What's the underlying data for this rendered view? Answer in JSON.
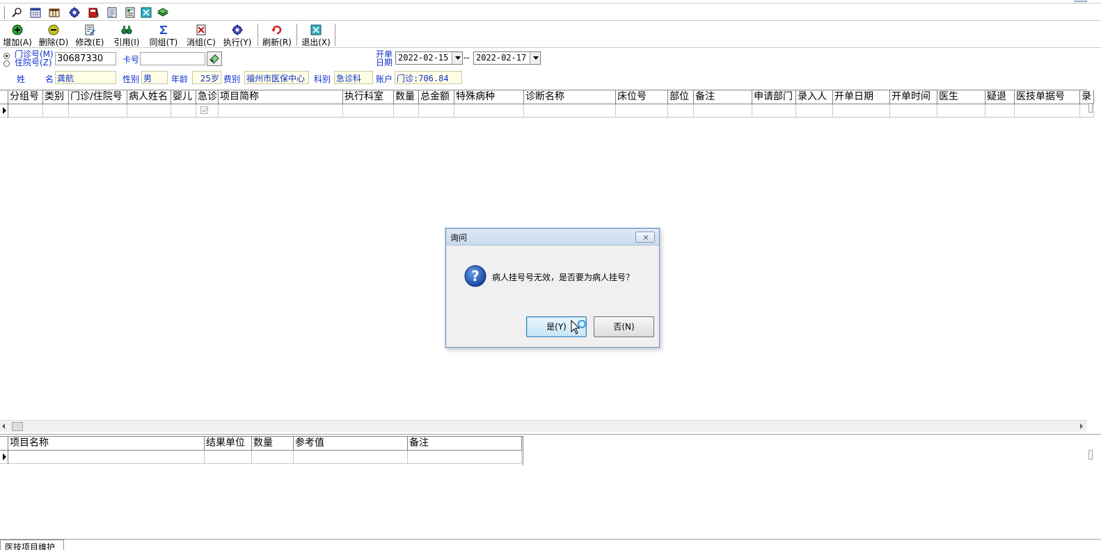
{
  "colors": {
    "label_blue": "#1030c8",
    "field_yellow": "#ffffe6"
  },
  "icon_toolbar": {
    "icons": [
      "search-icon",
      "calendar-icon",
      "table-icon",
      "gear-icon",
      "book-icon",
      "list-icon",
      "form-icon",
      "exit-icon",
      "stack-icon"
    ]
  },
  "toolbar": {
    "add": "增加(A)",
    "delete": "删除(D)",
    "edit": "修改(E)",
    "reference": "引用(I)",
    "group": "同组(T)",
    "ungroup": "消组(C)",
    "execute": "执行(Y)",
    "refresh": "刷新(R)",
    "exit": "退出(X)"
  },
  "patient": {
    "outpatient_label": "门诊号(M)",
    "inpatient_label": "住院号(Z)",
    "number": "30687330",
    "card_label": "卡号",
    "card_value": "",
    "name_label_1": "姓",
    "name_label_2": "名",
    "name": "龚航",
    "sex_label": "性别",
    "sex": "男",
    "age_label": "年龄",
    "age": "25岁",
    "fee_label": "费别",
    "fee": "福州市医保中心",
    "dept_label": "科别",
    "dept": "急诊科",
    "account_label": "账户",
    "account": "门诊:706.84",
    "date_label_1": "开单",
    "date_label_2": "日期",
    "date_from": "2022-02-15",
    "date_sep": "--",
    "date_to": "2022-02-17"
  },
  "main_grid": {
    "columns": [
      "分组号",
      "类别",
      "门诊/住院号",
      "病人姓名",
      "婴儿",
      "急诊",
      "项目简称",
      "执行科室",
      "数量",
      "总金额",
      "特殊病种",
      "诊断名称",
      "床位号",
      "部位",
      "备注",
      "申请部门",
      "录入人",
      "开单日期",
      "开单时间",
      "医生",
      "疑退",
      "医技单据号",
      "录"
    ]
  },
  "detail_grid": {
    "columns": [
      "项目名称",
      "结果单位",
      "数量",
      "参考值",
      "备注"
    ]
  },
  "bottom_tab": "医技项目维护",
  "dialog": {
    "title": "询问",
    "message": "病人挂号号无效，是否要为病人挂号？",
    "yes": "是(Y)",
    "no": "否(N)"
  }
}
